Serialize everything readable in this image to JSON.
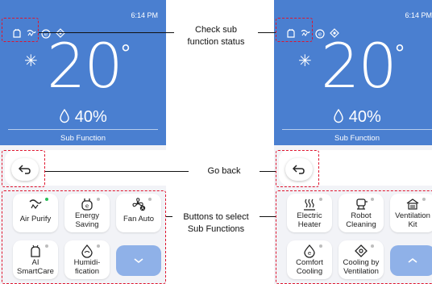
{
  "left_screen": {
    "time": "6:14 PM",
    "temperature": "20",
    "temperature_unit": "°",
    "humidity": "40%",
    "sub_function_title": "Sub Function",
    "buttons": [
      {
        "line1": "Air Purify",
        "line2": "",
        "icon": "air-purify-icon",
        "status": "on"
      },
      {
        "line1": "Energy",
        "line2": "Saving",
        "icon": "energy-saving-icon",
        "status": "off"
      },
      {
        "line1": "Fan Auto",
        "line2": "",
        "icon": "fan-auto-icon",
        "status": "off"
      },
      {
        "line1": "AI",
        "line2": "SmartCare",
        "icon": "ai-smartcare-icon",
        "status": "off"
      },
      {
        "line1": "Humidi-",
        "line2": "fication",
        "icon": "humidification-icon",
        "status": "off"
      }
    ],
    "toggle_icon": "chevron-down-icon"
  },
  "right_screen": {
    "time": "6:14 PM",
    "temperature": "20",
    "temperature_unit": "°",
    "humidity": "40%",
    "sub_function_title": "Sub Function",
    "buttons": [
      {
        "line1": "Electric",
        "line2": "Heater",
        "icon": "electric-heater-icon",
        "status": "off"
      },
      {
        "line1": "Robot",
        "line2": "Cleaning",
        "icon": "robot-cleaning-icon",
        "status": "off"
      },
      {
        "line1": "Ventilation",
        "line2": "Kit",
        "icon": "ventilation-kit-icon",
        "status": "off"
      },
      {
        "line1": "Comfort",
        "line2": "Cooling",
        "icon": "comfort-cooling-icon",
        "status": "off"
      },
      {
        "line1": "Cooling by",
        "line2": "Ventilation",
        "icon": "cooling-by-ventilation-icon",
        "status": "off"
      }
    ],
    "toggle_icon": "chevron-up-icon"
  },
  "annotations": {
    "check_status_line1": "Check sub",
    "check_status_line2": "function status",
    "go_back": "Go back",
    "select_line1": "Buttons to select",
    "select_line2": "Sub Functions"
  },
  "colors": {
    "panel_blue": "#4a7fd0",
    "highlight_red": "#e0142d",
    "status_on_green": "#2bbf5a",
    "expand_button_blue": "#8fb1e8"
  }
}
